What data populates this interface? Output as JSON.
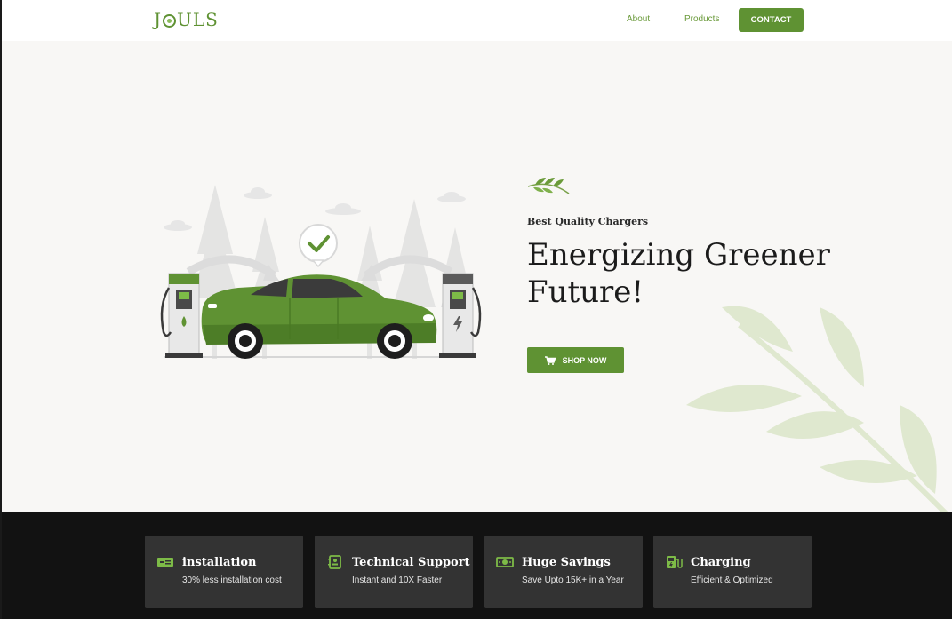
{
  "brand": {
    "logo_text_left": "J",
    "logo_text_right": "ULS",
    "accent": "#5f9233"
  },
  "nav": {
    "about": "About",
    "products": "Products",
    "contact": "CONTACT"
  },
  "hero": {
    "tagline": "Best Quality Chargers",
    "headline": "Energizing Greener Future!",
    "shop_label": "SHOP NOW",
    "shop_icon": "cart-icon",
    "illustration": "electric-car-charging-illustration",
    "background": "#f8f7f5"
  },
  "features": [
    {
      "icon": "cash-icon",
      "title": "installation",
      "desc": "30% less installation cost"
    },
    {
      "icon": "support-book-icon",
      "title": "Technical Support",
      "desc": "Instant and 10X Faster"
    },
    {
      "icon": "money-icon",
      "title": "Huge Savings",
      "desc": "Save Upto 15K+ in a Year"
    },
    {
      "icon": "charging-station-icon",
      "title": "Charging",
      "desc": "Efficient & Optimized"
    }
  ]
}
